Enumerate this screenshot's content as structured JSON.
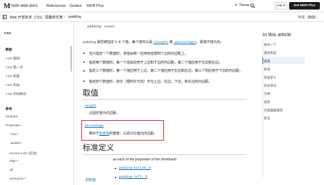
{
  "header": {
    "logo_mark": "M",
    "logo_text": "mdn web docs",
    "nav": [
      "References",
      "Guides",
      "MDN Plus"
    ],
    "theme": "Theme",
    "login": "Log in",
    "get_plus": "Get MDN Plus"
  },
  "breadcrumbs": [
    "Web 开发技术",
    "CSS：层叠样式表",
    "padding"
  ],
  "lang": "中文（简体）",
  "sidebar": {
    "items": [
      "CSS",
      "教程",
      "CSS 基础",
      "CSS 第一步",
      "CSS 构建",
      "CSS 布局",
      "CSS 布局概述",
      "参考",
      "Modules",
      "Properties",
      "-moz-*",
      "-webkit-*",
      "accent-color (实验)",
      "align-*",
      "all",
      "animation-*"
    ]
  },
  "main": {
    "top_code": "padding: unset;",
    "intro_pre": "padding",
    "intro_text": " 属性被指定 1~4 个值，每个值可以是 ",
    "intro_link1": "<length>",
    "intro_mid": " 或 ",
    "intro_link2": "<percentage>",
    "intro_end": "。取值不能为负。",
    "bullets": [
      "当只指定一个数值时，该值会统一应用到全部四个边的内边距上。",
      "指定两个数值时，第一个值会应用于上边和下边的内边距，第二个值应用于左边和右边。",
      "指定三个数值时，第一个值应用于上边，第二个值应用于右边和左边，第三个则应用于下边的内边距。",
      "指定四个数值时，依次（顺时针方向）作为上边，右边，下边，和左边的内边距。"
    ],
    "h_values": "取值",
    "length_term": "length",
    "length_desc": "以固定值为内边距。",
    "percentage_term": "percentage",
    "percentage_pre": "相对于",
    "percentage_link": "包含块",
    "percentage_desc": "的宽度，以百分比值为内边距。",
    "h_formal": "标准定义",
    "formal_text": "as each of the properties of the shorthand:",
    "initial_label": "初始值",
    "shorthand": [
      "padding-bottom: 0",
      "padding-left: 0"
    ]
  },
  "toc": {
    "title": "In this article",
    "items": [
      "尝试一下",
      "属性构成",
      "语法",
      "取值",
      "标准定义",
      "形式语法",
      "示例",
      "规范",
      "浏览器兼容性",
      "参见"
    ],
    "active": "语法"
  }
}
